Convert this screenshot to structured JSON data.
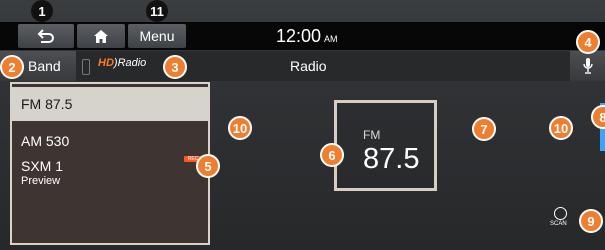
{
  "topbar": {
    "menu_label": "Menu",
    "clock": "12:00",
    "ampm": "AM"
  },
  "source_bar": {
    "band_label": "Band",
    "logo_hd": "HD",
    "logo_radio": "Radio",
    "title": "Radio"
  },
  "stations": [
    {
      "label": "FM 87.5",
      "sub": ""
    },
    {
      "label": "AM 530",
      "sub": ""
    },
    {
      "label": "SXM 1",
      "sub": "Preview"
    }
  ],
  "rec_badge": "REC",
  "player": {
    "band": "FM",
    "frequency": "87.5",
    "favorite": true
  },
  "scan_label": "SCAN",
  "callouts": {
    "c1": "1",
    "c2": "2",
    "c3": "3",
    "c4": "4",
    "c5": "5",
    "c6": "6",
    "c7": "7",
    "c8": "8",
    "c9": "9",
    "c10a": "10",
    "c10b": "10",
    "c11": "11"
  },
  "colors": {
    "callout": "#ef7e2f",
    "favorite_star": "#3aa1f2",
    "hd_logo": "#ff7a2a",
    "selected_item": "#d6d2cc"
  },
  "icons": {
    "back": "back-arrow-icon",
    "home": "home-icon",
    "mic": "microphone-icon",
    "star": "star-icon",
    "scan": "scan-icon",
    "prev": "previous-arrow-icon",
    "next": "next-arrow-icon"
  }
}
